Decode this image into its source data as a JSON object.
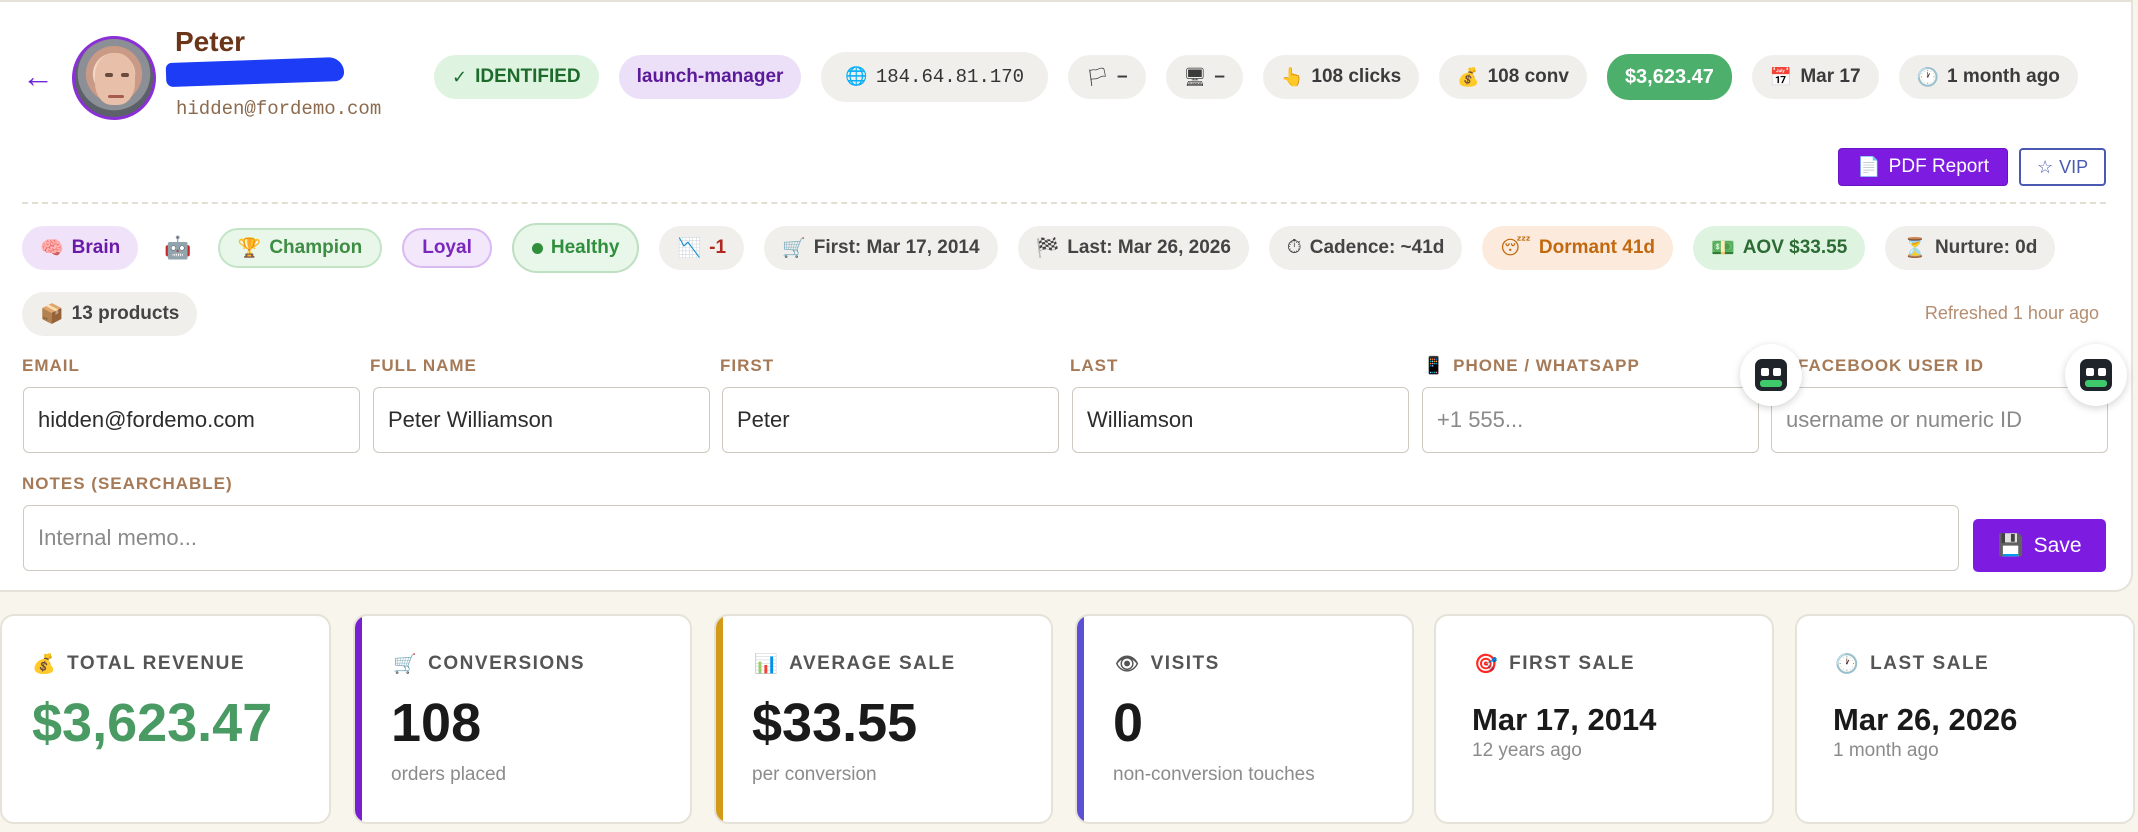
{
  "profile": {
    "name": "Peter",
    "email_display": "hidden@fordemo.com"
  },
  "top_chips": {
    "identified": "IDENTIFIED",
    "role": "launch-manager",
    "ip": "184.64.81.170",
    "country": "–",
    "device": "–",
    "clicks": "108 clicks",
    "conversions": "108 conv",
    "revenue": "$3,623.47",
    "date": "Mar 17",
    "ago": "1 month ago"
  },
  "actions": {
    "pdf_report": "PDF Report",
    "vip": "VIP"
  },
  "tags": {
    "brain": "Brain",
    "champion": "Champion",
    "loyal": "Loyal",
    "healthy": "Healthy",
    "trend": "-1",
    "first": "First: Mar 17, 2014",
    "last": "Last: Mar 26, 2026",
    "cadence": "Cadence: ~41d",
    "dormant": "Dormant 41d",
    "aov": "AOV $33.55",
    "nurture": "Nurture: 0d",
    "products": "13 products"
  },
  "refreshed": "Refreshed 1 hour ago",
  "form": {
    "email_label": "EMAIL",
    "email_value": "hidden@fordemo.com",
    "fullname_label": "FULL NAME",
    "fullname_value": "Peter Williamson",
    "first_label": "FIRST",
    "first_value": "Peter",
    "last_label": "LAST",
    "last_value": "Williamson",
    "phone_label": "PHONE / WHATSAPP",
    "phone_placeholder": "+1 555...",
    "facebook_label": "FACEBOOK USER ID",
    "facebook_placeholder": "username or numeric ID",
    "notes_label": "NOTES (SEARCHABLE)",
    "notes_placeholder": "Internal memo...",
    "save_label": "Save"
  },
  "stats": [
    {
      "label": "TOTAL REVENUE",
      "value": "$3,623.47",
      "sub": "",
      "icon": "money-bag-icon",
      "color": "#4a9a63"
    },
    {
      "label": "CONVERSIONS",
      "value": "108",
      "sub": "orders placed",
      "icon": "cart-icon",
      "color": "#7a1fd0"
    },
    {
      "label": "AVERAGE SALE",
      "value": "$33.55",
      "sub": "per conversion",
      "icon": "bar-chart-icon",
      "color": "#d39a1a"
    },
    {
      "label": "VISITS",
      "value": "0",
      "sub": "non-conversion touches",
      "icon": "eye-icon",
      "color": "#5b4fd6"
    },
    {
      "label": "FIRST SALE",
      "value": "Mar 17, 2014",
      "sub": "12 years ago",
      "icon": "target-icon",
      "color": ""
    },
    {
      "label": "LAST SALE",
      "value": "Mar 26, 2026",
      "sub": "1 month ago",
      "icon": "clock-icon",
      "color": ""
    }
  ]
}
